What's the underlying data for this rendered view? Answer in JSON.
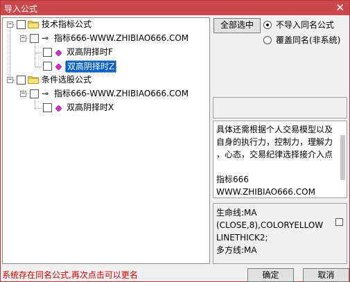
{
  "window": {
    "title": "导入公式",
    "close_glyph": "✕"
  },
  "tree": {
    "groups": [
      {
        "label": "技术指标公式",
        "source": {
          "label": "指标666-WWW.ZHIBIAO666.COM",
          "items": [
            {
              "label": "双高阴择时F",
              "selected": false
            },
            {
              "label": "双高阴择时Z",
              "selected": true
            }
          ]
        }
      },
      {
        "label": "条件选股公式",
        "source": {
          "label": "指标666-WWW.ZHIBIAO666.COM",
          "items": [
            {
              "label": "双高阴择时X",
              "selected": false
            }
          ]
        }
      }
    ]
  },
  "options": {
    "select_all_label": "全部选中",
    "radio_skip_label": "不导入同名公式",
    "radio_overwrite_label": "覆盖同名(非系统)",
    "selected_radio": "skip"
  },
  "description": {
    "lines": [
      "具体还需根据个人交易模型以及",
      "自身的执行力，控制力，理解力",
      "，心态，交易纪律选择接介入点",
      "",
      "指标666",
      "WWW.ZHIBIAO666.COM"
    ]
  },
  "formula": {
    "lines": [
      "生命线:MA",
      "(CLOSE,8),COLORYELLOW",
      "LINETHICK2;",
      "多方线:MA"
    ]
  },
  "footer": {
    "status_text": "系统存在同名公式,再次点击可以更名",
    "ok_label": "确定",
    "cancel_label": "取消"
  },
  "colors": {
    "titlebar": "#c8484c",
    "selection": "#0a62d0",
    "folder": "#f3d25a",
    "diamond": "#d12fd0",
    "status_text": "#d00000"
  },
  "icons": {
    "folder": "folder-icon",
    "key": "key-icon",
    "formula": "diamond-icon",
    "expand": "expand-box-icon"
  }
}
